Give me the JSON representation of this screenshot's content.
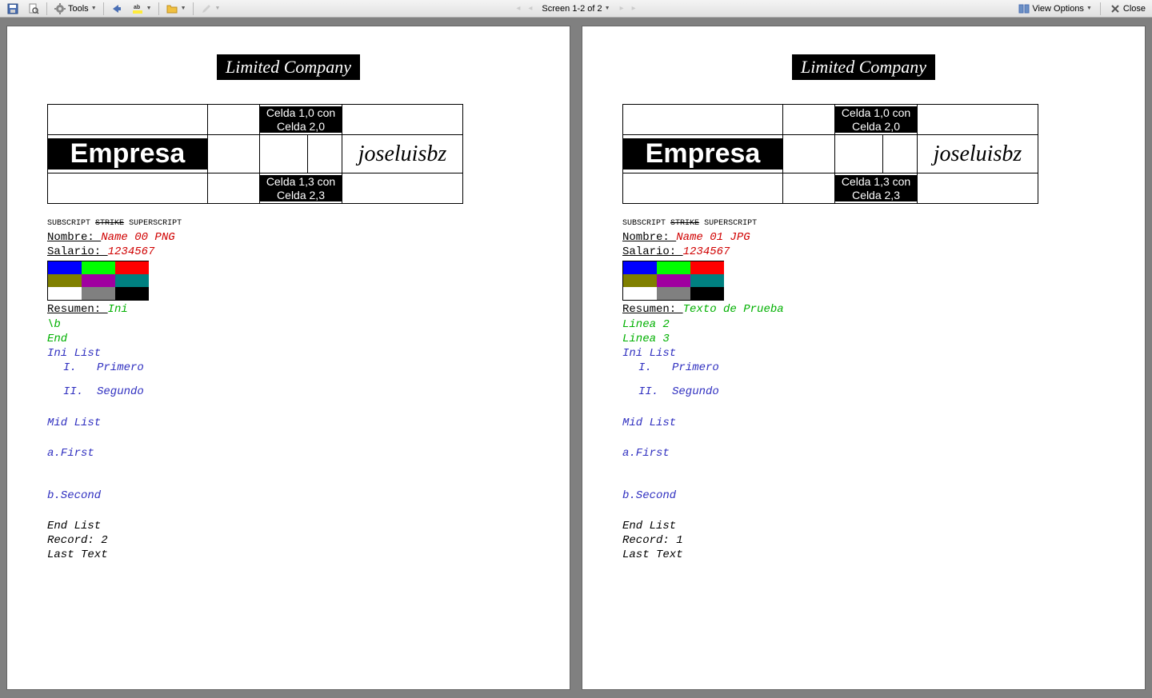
{
  "toolbar": {
    "tools_label": "Tools",
    "screen_label": "Screen 1-2 of 2",
    "view_options_label": "View Options",
    "close_label": "Close"
  },
  "banner_title": "Limited Company",
  "table": {
    "cell_1_0": "Celda 1,0 con Celda 2,0",
    "empresa": "Empresa",
    "joseluisbz": "joseluisbz",
    "cell_1_3": "Celda 1,3 con Celda 2,3"
  },
  "tiny": {
    "subscript": "SUBSCRIPT",
    "strike": "STRIKE",
    "superscript": "SUPERSCRIPT"
  },
  "labels": {
    "nombre": "Nombre: ",
    "salario": "Salario: ",
    "resumen": "Resumen: "
  },
  "swatches": [
    "#0000ff",
    "#00ff00",
    "#ff0000",
    "#808000",
    "#a000a0",
    "#008080",
    "#ffffff",
    "#808080",
    "#000000"
  ],
  "common": {
    "salario": "1234567",
    "ini_list": "Ini List",
    "primero": "I.   Primero",
    "segundo": "II.  Segundo",
    "mid_list": "Mid List",
    "first": "a.First",
    "second": "b.Second",
    "end_list": "End List",
    "last_text": "Last Text"
  },
  "pages": [
    {
      "nombre": "Name 00 PNG",
      "resumen_first": "Ini",
      "resumen_lines": [
        "\\b",
        "End"
      ],
      "record": "Record: 2"
    },
    {
      "nombre": "Name 01 JPG",
      "resumen_first": "Texto de Prueba",
      "resumen_lines": [
        "Linea 2",
        "Linea 3"
      ],
      "record": "Record: 1"
    }
  ]
}
